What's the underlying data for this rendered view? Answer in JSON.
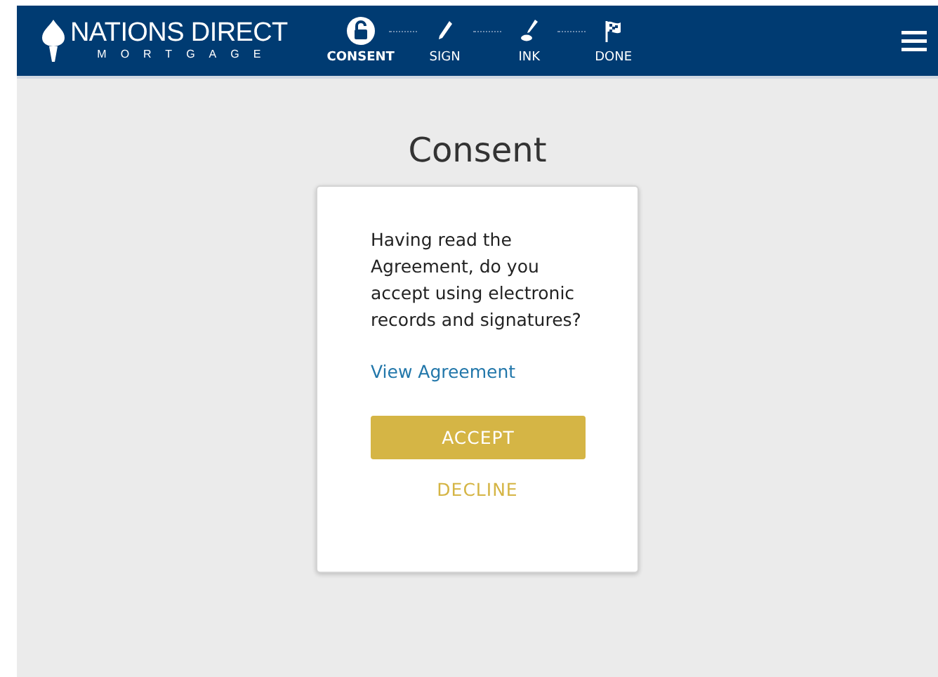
{
  "brand": {
    "name": "NATIONS DIRECT",
    "tagline": "MORTGAGE"
  },
  "steps": [
    {
      "label": "CONSENT",
      "kind": "lock",
      "selected": true
    },
    {
      "label": "SIGN",
      "kind": "pen",
      "selected": false
    },
    {
      "label": "INK",
      "kind": "ink",
      "selected": false
    },
    {
      "label": "DONE",
      "kind": "flag",
      "selected": false
    }
  ],
  "page_title": "Consent",
  "card": {
    "question": "Having read the Agreement, do you accept using electronic records and signatures?",
    "link": "View Agreement",
    "accept": "ACCEPT",
    "decline": "DECLINE"
  }
}
